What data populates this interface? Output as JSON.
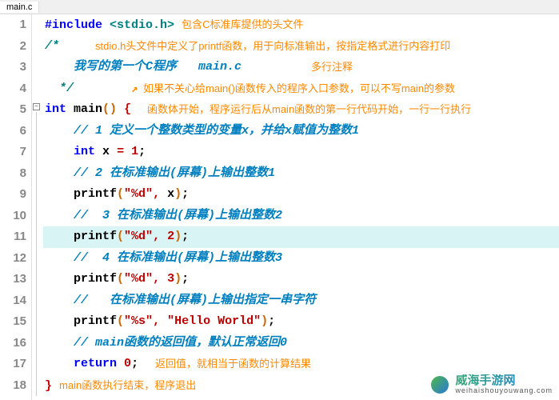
{
  "tab": {
    "filename": "main.c"
  },
  "gutter": {
    "lines": [
      "1",
      "2",
      "3",
      "4",
      "5",
      "6",
      "7",
      "8",
      "9",
      "10",
      "11",
      "12",
      "13",
      "14",
      "15",
      "16",
      "17",
      "18"
    ]
  },
  "code": {
    "l1_include": "#include",
    "l1_header": "<stdio.h>",
    "l2_cmt_open": "/*",
    "l3_cmt": "我写的第一个C程序   main.c",
    "l4_cmt_close": "*/",
    "l5_int": "int",
    "l5_main": "main",
    "l5_paren": "()",
    "l5_brace": "{",
    "l6_cmt": "// 1 定义一个整数类型的变量x，并给x赋值为整数1",
    "l7_int": "int",
    "l7_id": "x",
    "l7_eq": "=",
    "l7_num": "1",
    "l7_semi": ";",
    "l8_cmt": "// 2 在标准输出(屏幕)上输出整数1",
    "l9_fn": "printf",
    "l9_p1": "(",
    "l9_s": "\"%d\"",
    "l9_c": ",",
    "l9_arg": " x",
    "l9_p2": ")",
    "l9_semi": ";",
    "l10_cmt": "//  3 在标准输出(屏幕)上输出整数2",
    "l11_fn": "printf",
    "l11_p1": "(",
    "l11_s": "\"%d\"",
    "l11_c": ",",
    "l11_arg": " 2",
    "l11_p2": ")",
    "l11_semi": ";",
    "l12_cmt": "//  4 在标准输出(屏幕)上输出整数3",
    "l13_fn": "printf",
    "l13_p1": "(",
    "l13_s": "\"%d\"",
    "l13_c": ",",
    "l13_arg": " 3",
    "l13_p2": ")",
    "l13_semi": ";",
    "l14_cmt": "//   在标准输出(屏幕)上输出指定一串字符",
    "l15_fn": "printf",
    "l15_p1": "(",
    "l15_s1": "\"%s\"",
    "l15_c": ",",
    "l15_s2": " \"Hello World\"",
    "l15_p2": ")",
    "l15_semi": ";",
    "l16_cmt": "// main函数的返回值，默认正常返回0",
    "l17_ret": "return",
    "l17_num": "0",
    "l17_semi": ";",
    "l18_brace": "}"
  },
  "annotations": {
    "a1": "包含C标准库提供的头文件",
    "a2": "stdio.h头文件中定义了printf函数，用于向标准输出，按指定格式进行内容打印",
    "a3": "多行注释",
    "a4": "如果不关心给main()函数传入的程序入口参数，可以不写main的参数",
    "a5": "函数体开始，程序运行后从main函数的第一行代码开始，一行一行执行",
    "a17": "返回值，就相当于函数的计算结果",
    "a18": "main函数执行结束，程序退出"
  },
  "watermark": {
    "cn": "威海手游网",
    "domain": "weihaishouyouwang.com"
  }
}
